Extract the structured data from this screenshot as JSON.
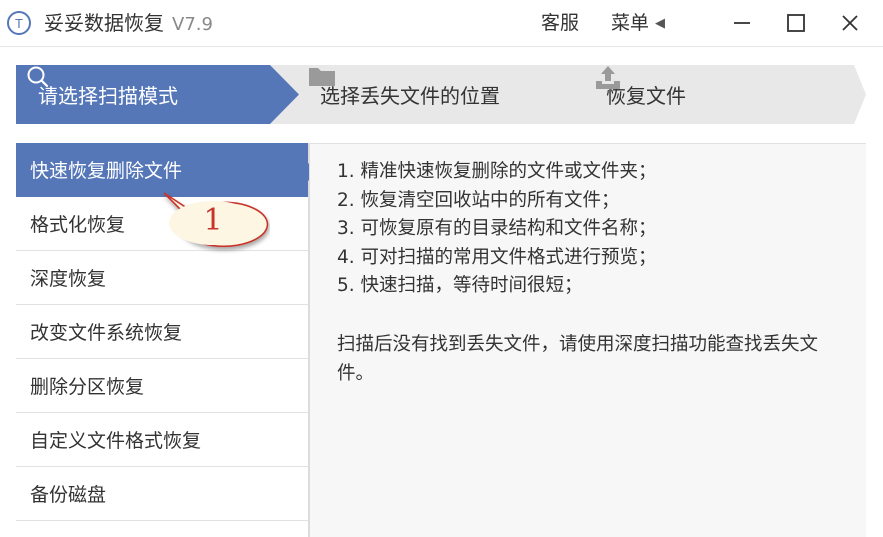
{
  "app": {
    "title": "妥妥数据恢复",
    "version": "V7.9",
    "logo_text": "T"
  },
  "titlebar": {
    "support_label": "客服",
    "menu_label": "菜单",
    "menu_arrow": "◀",
    "icons": [
      "minimize-icon",
      "maximize-icon",
      "close-icon"
    ]
  },
  "steps": [
    {
      "label": "请选择扫描模式",
      "icon": "search-icon",
      "active": true
    },
    {
      "label": "选择丢失文件的位置",
      "icon": "folder-icon",
      "active": false
    },
    {
      "label": "恢复文件",
      "icon": "upload-icon",
      "active": false
    }
  ],
  "modes": [
    {
      "label": "快速恢复删除文件",
      "active": true
    },
    {
      "label": "格式化恢复",
      "active": false
    },
    {
      "label": "深度恢复",
      "active": false
    },
    {
      "label": "改变文件系统恢复",
      "active": false
    },
    {
      "label": "删除分区恢复",
      "active": false
    },
    {
      "label": "自定义文件格式恢复",
      "active": false
    },
    {
      "label": "备份磁盘",
      "active": false
    }
  ],
  "description": {
    "lines": [
      "1. 精准快速恢复删除的文件或文件夹；",
      "2. 恢复清空回收站中的所有文件；",
      "3. 可恢复原有的目录结构和文件名称；",
      "4. 可对扫描的常用文件格式进行预览；",
      "5. 快速扫描，等待时间很短；"
    ],
    "note": "扫描后没有找到丢失文件，请使用深度扫描功能查找丢失文件。"
  },
  "annotation": {
    "number": "1"
  },
  "colors": {
    "accent": "#5577b8",
    "step_inactive": "#e8e8e8",
    "panel_bg": "#f7f7f7",
    "callout_fill": "#fdf6e3",
    "callout_text": "#c8342a"
  }
}
